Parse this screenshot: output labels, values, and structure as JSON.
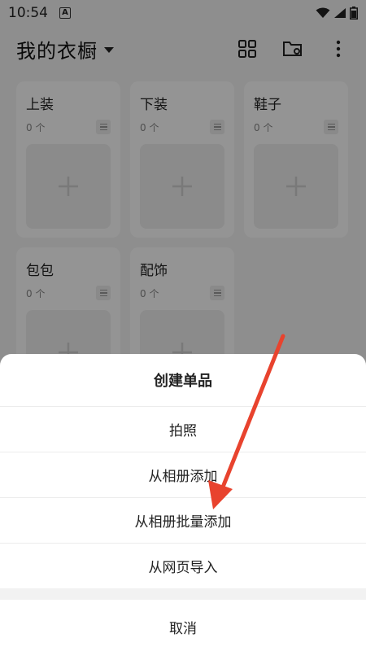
{
  "status_bar": {
    "time": "10:54",
    "notif_letter": "A"
  },
  "app_bar": {
    "title": "我的衣橱"
  },
  "categories": [
    {
      "name": "上装",
      "count": "0 个"
    },
    {
      "name": "下装",
      "count": "0 个"
    },
    {
      "name": "鞋子",
      "count": "0 个"
    },
    {
      "name": "包包",
      "count": "0 个"
    },
    {
      "name": "配饰",
      "count": "0 个"
    }
  ],
  "sheet": {
    "title": "创建单品",
    "options": [
      "拍照",
      "从相册添加",
      "从相册批量添加",
      "从网页导入"
    ],
    "cancel": "取消"
  },
  "colors": {
    "annotation_arrow": "#e8432e"
  }
}
